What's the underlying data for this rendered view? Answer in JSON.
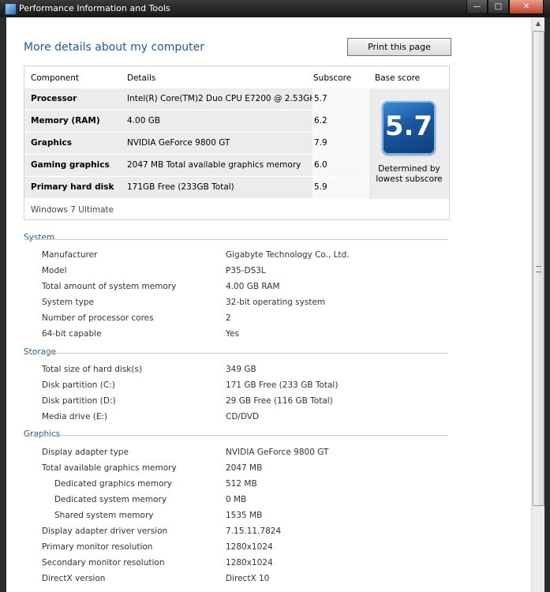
{
  "window": {
    "title": "Performance Information and Tools"
  },
  "main": {
    "heading": "More details about my computer",
    "print_label": "Print this page"
  },
  "score_table": {
    "headers": {
      "component": "Component",
      "details": "Details",
      "subscore": "Subscore",
      "base": "Base score"
    },
    "rows": [
      {
        "component": "Processor",
        "details": "Intel(R) Core(TM)2 Duo CPU E7200 @ 2.53GHz",
        "subscore": "5.7"
      },
      {
        "component": "Memory (RAM)",
        "details": "4.00 GB",
        "subscore": "6.2"
      },
      {
        "component": "Graphics",
        "details": "NVIDIA GeForce 9800 GT",
        "subscore": "7.9"
      },
      {
        "component": "Gaming graphics",
        "details": "2047 MB Total available graphics memory",
        "subscore": "6.0"
      },
      {
        "component": "Primary hard disk",
        "details": "171GB Free (233GB Total)",
        "subscore": "5.9"
      }
    ],
    "base_score": "5.7",
    "determined": "Determined by lowest subscore",
    "os": "Windows 7 Ultimate"
  },
  "system": {
    "title": "System",
    "rows": [
      {
        "label": "Manufacturer",
        "value": "Gigabyte Technology Co., Ltd."
      },
      {
        "label": "Model",
        "value": "P35-DS3L"
      },
      {
        "label": "Total amount of system memory",
        "value": "4.00 GB RAM"
      },
      {
        "label": "System type",
        "value": "32-bit operating system"
      },
      {
        "label": "Number of processor cores",
        "value": "2"
      },
      {
        "label": "64-bit capable",
        "value": "Yes"
      }
    ]
  },
  "storage": {
    "title": "Storage",
    "rows": [
      {
        "label": "Total size of hard disk(s)",
        "value": "349 GB"
      },
      {
        "label": "Disk partition (C:)",
        "value": "171 GB Free (233 GB Total)"
      },
      {
        "label": "Disk partition (D:)",
        "value": "29 GB Free (116 GB Total)"
      },
      {
        "label": "Media drive (E:)",
        "value": "CD/DVD"
      }
    ]
  },
  "graphics": {
    "title": "Graphics",
    "rows": [
      {
        "label": "Display adapter type",
        "value": "NVIDIA GeForce 9800 GT"
      },
      {
        "label": "Total available graphics memory",
        "value": "2047 MB"
      },
      {
        "label": "Dedicated graphics memory",
        "value": "512 MB"
      },
      {
        "label": "Dedicated system memory",
        "value": "0 MB"
      },
      {
        "label": "Shared system memory",
        "value": "1535 MB"
      },
      {
        "label": "Display adapter driver version",
        "value": "7.15.11.7824"
      },
      {
        "label": "Primary monitor resolution",
        "value": "1280x1024"
      },
      {
        "label": "Secondary monitor resolution",
        "value": "1280x1024"
      },
      {
        "label": "DirectX version",
        "value": "DirectX 10"
      }
    ]
  }
}
